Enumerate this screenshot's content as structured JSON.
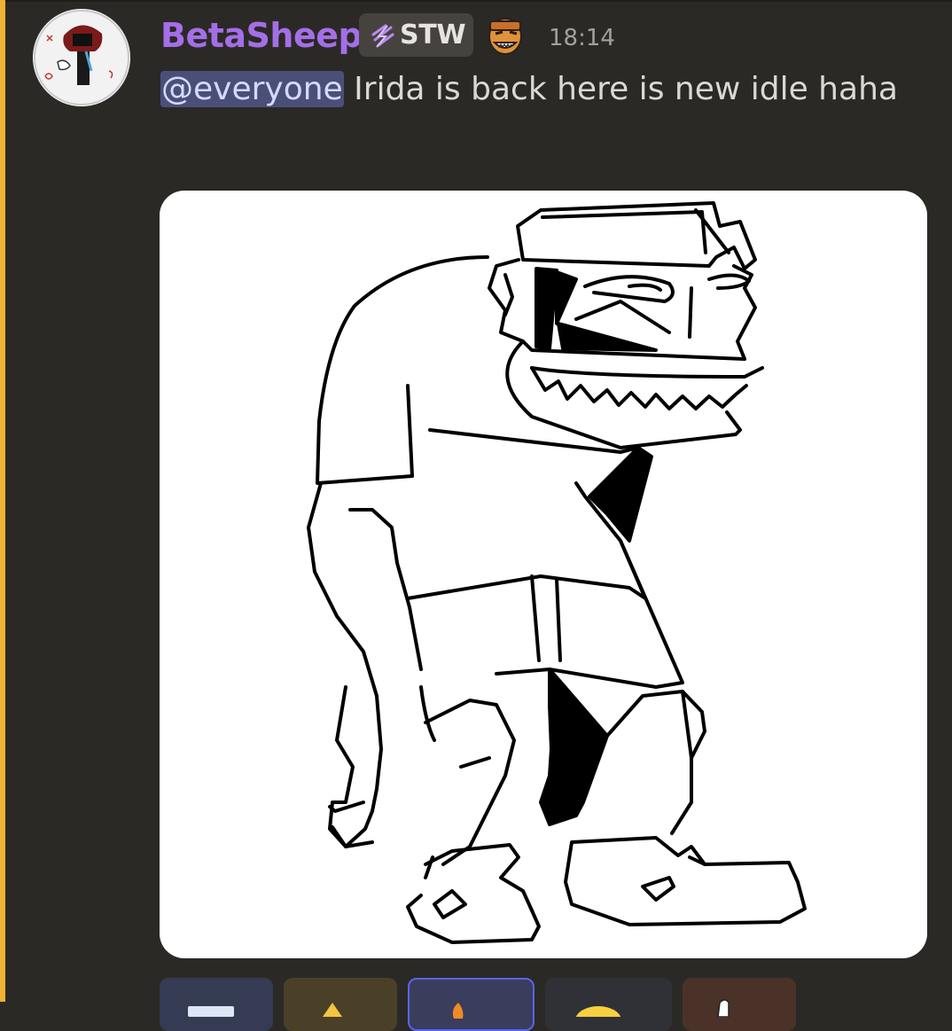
{
  "message": {
    "author": "BetaSheep",
    "author_color": "#a46ee8",
    "tag_label": "STW",
    "timestamp": "18:14",
    "mention": "@everyone",
    "text": " Irida is back here is new idle haha",
    "highlight_color": "#f0b232"
  },
  "attachment": {
    "kind": "image",
    "subject": "black-and-white line drawing of a grinning cartoon character"
  },
  "reactions": [
    {
      "icon": "id-card-emoji",
      "selected": false
    },
    {
      "icon": "warning-emoji",
      "selected": false
    },
    {
      "icon": "fire-emoji",
      "selected": true
    },
    {
      "icon": "smiley-emoji",
      "selected": false
    },
    {
      "icon": "hand-emoji",
      "selected": false
    }
  ]
}
